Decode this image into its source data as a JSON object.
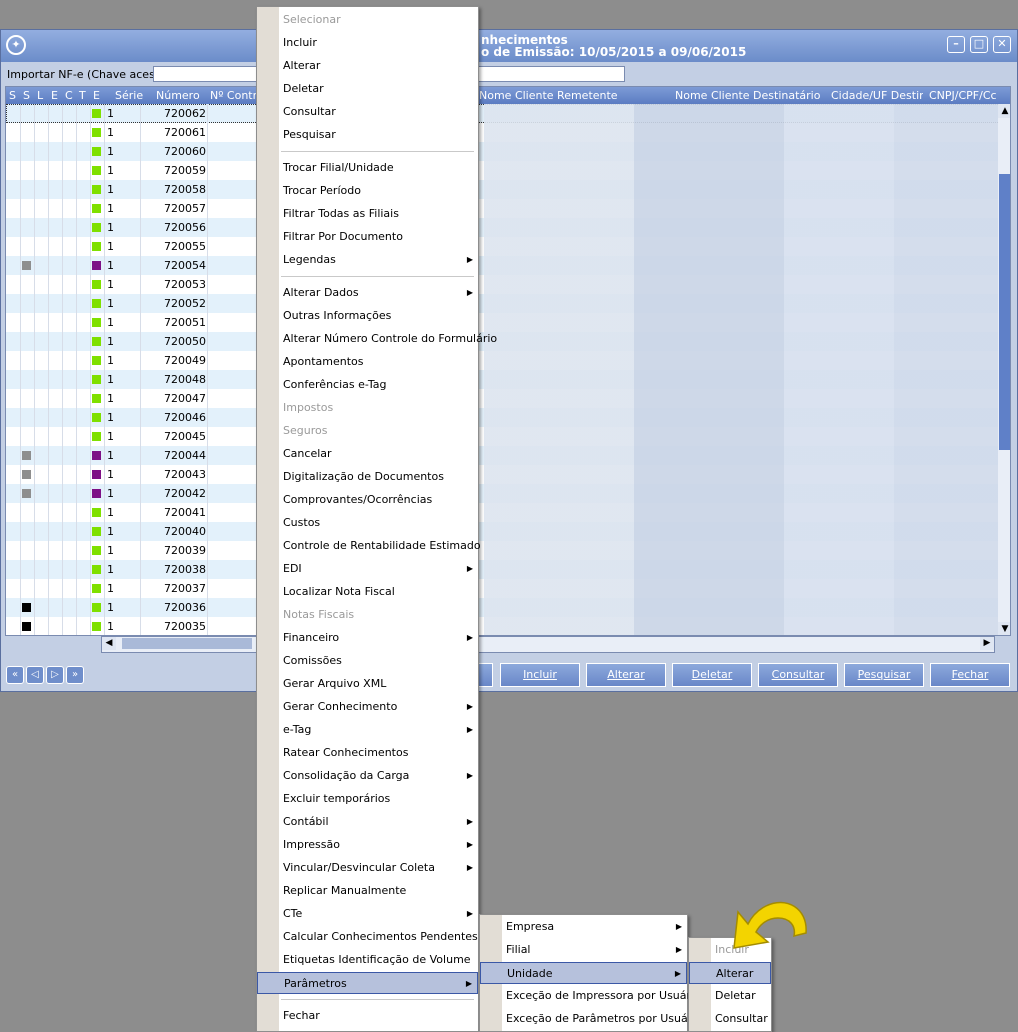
{
  "window": {
    "title_line1": "nhecimentos",
    "title_line2": "o de Emissão: 10/05/2015 a 09/06/2015",
    "logo": "compass-logo",
    "controls": [
      "minimize-icon",
      "maximize-icon",
      "close-icon"
    ]
  },
  "import": {
    "label": "Importar NF-e (Chave acesso):",
    "value": ""
  },
  "grid": {
    "headers": {
      "s": "S",
      "s2": "S",
      "l": "L",
      "e": "E",
      "c": "C",
      "t": "T",
      "e2": "E",
      "serie": "Série",
      "numero": "Número",
      "controle": "Nº Contro",
      "remetente": "Nome Cliente Remetente",
      "destinatario": "Nome Cliente Destinatário",
      "cidade": "Cidade/UF Destino",
      "cnpj": "CNPJ/CPF/Cc"
    },
    "rows": [
      {
        "serie": "1",
        "numero": "720062",
        "s_mark": "",
        "e_mark": "green"
      },
      {
        "serie": "1",
        "numero": "720061",
        "s_mark": "",
        "e_mark": "green"
      },
      {
        "serie": "1",
        "numero": "720060",
        "s_mark": "",
        "e_mark": "green"
      },
      {
        "serie": "1",
        "numero": "720059",
        "s_mark": "",
        "e_mark": "green"
      },
      {
        "serie": "1",
        "numero": "720058",
        "s_mark": "",
        "e_mark": "green"
      },
      {
        "serie": "1",
        "numero": "720057",
        "s_mark": "",
        "e_mark": "green"
      },
      {
        "serie": "1",
        "numero": "720056",
        "s_mark": "",
        "e_mark": "green"
      },
      {
        "serie": "1",
        "numero": "720055",
        "s_mark": "",
        "e_mark": "green"
      },
      {
        "serie": "1",
        "numero": "720054",
        "s_mark": "gray",
        "e_mark": "purple"
      },
      {
        "serie": "1",
        "numero": "720053",
        "s_mark": "",
        "e_mark": "green"
      },
      {
        "serie": "1",
        "numero": "720052",
        "s_mark": "",
        "e_mark": "green"
      },
      {
        "serie": "1",
        "numero": "720051",
        "s_mark": "",
        "e_mark": "green"
      },
      {
        "serie": "1",
        "numero": "720050",
        "s_mark": "",
        "e_mark": "green"
      },
      {
        "serie": "1",
        "numero": "720049",
        "s_mark": "",
        "e_mark": "green"
      },
      {
        "serie": "1",
        "numero": "720048",
        "s_mark": "",
        "e_mark": "green"
      },
      {
        "serie": "1",
        "numero": "720047",
        "s_mark": "",
        "e_mark": "green"
      },
      {
        "serie": "1",
        "numero": "720046",
        "s_mark": "",
        "e_mark": "green"
      },
      {
        "serie": "1",
        "numero": "720045",
        "s_mark": "",
        "e_mark": "green"
      },
      {
        "serie": "1",
        "numero": "720044",
        "s_mark": "gray",
        "e_mark": "purple"
      },
      {
        "serie": "1",
        "numero": "720043",
        "s_mark": "gray",
        "e_mark": "purple"
      },
      {
        "serie": "1",
        "numero": "720042",
        "s_mark": "gray",
        "e_mark": "purple"
      },
      {
        "serie": "1",
        "numero": "720041",
        "s_mark": "",
        "e_mark": "green"
      },
      {
        "serie": "1",
        "numero": "720040",
        "s_mark": "",
        "e_mark": "green"
      },
      {
        "serie": "1",
        "numero": "720039",
        "s_mark": "",
        "e_mark": "green"
      },
      {
        "serie": "1",
        "numero": "720038",
        "s_mark": "",
        "e_mark": "green"
      },
      {
        "serie": "1",
        "numero": "720037",
        "s_mark": "",
        "e_mark": "green"
      },
      {
        "serie": "1",
        "numero": "720036",
        "s_mark": "black",
        "e_mark": "green"
      },
      {
        "serie": "1",
        "numero": "720035",
        "s_mark": "black",
        "e_mark": "green"
      }
    ]
  },
  "nav_buttons": [
    "first-icon",
    "prev-icon",
    "next-icon",
    "last-icon"
  ],
  "actions": [
    "Incluir",
    "Alterar",
    "Deletar",
    "Consultar",
    "Pesquisar",
    "Fechar"
  ],
  "context_menu": {
    "items": [
      {
        "label": "Selecionar",
        "disabled": true,
        "sub": false
      },
      {
        "label": "Incluir",
        "disabled": false,
        "sub": false
      },
      {
        "label": "Alterar",
        "disabled": false,
        "sub": false
      },
      {
        "label": "Deletar",
        "disabled": false,
        "sub": false
      },
      {
        "label": "Consultar",
        "disabled": false,
        "sub": false
      },
      {
        "label": "Pesquisar",
        "disabled": false,
        "sub": false
      },
      {
        "label": "Trocar Filial/Unidade",
        "disabled": false,
        "sub": false
      },
      {
        "label": "Trocar Período",
        "disabled": false,
        "sub": false
      },
      {
        "label": "Filtrar Todas as Filiais",
        "disabled": false,
        "sub": false
      },
      {
        "label": "Filtrar Por Documento",
        "disabled": false,
        "sub": false
      },
      {
        "label": "Legendas",
        "disabled": false,
        "sub": true
      },
      {
        "label": "Alterar Dados",
        "disabled": false,
        "sub": true
      },
      {
        "label": "Outras Informações",
        "disabled": false,
        "sub": false
      },
      {
        "label": "Alterar Número Controle do Formulário",
        "disabled": false,
        "sub": false
      },
      {
        "label": "Apontamentos",
        "disabled": false,
        "sub": false
      },
      {
        "label": "Conferências e-Tag",
        "disabled": false,
        "sub": false
      },
      {
        "label": "Impostos",
        "disabled": true,
        "sub": false
      },
      {
        "label": "Seguros",
        "disabled": true,
        "sub": false
      },
      {
        "label": "Cancelar",
        "disabled": false,
        "sub": false
      },
      {
        "label": "Digitalização de Documentos",
        "disabled": false,
        "sub": false
      },
      {
        "label": "Comprovantes/Ocorrências",
        "disabled": false,
        "sub": false
      },
      {
        "label": "Custos",
        "disabled": false,
        "sub": false
      },
      {
        "label": "Controle de Rentabilidade Estimado",
        "disabled": false,
        "sub": false
      },
      {
        "label": "EDI",
        "disabled": false,
        "sub": true
      },
      {
        "label": "Localizar Nota Fiscal",
        "disabled": false,
        "sub": false
      },
      {
        "label": "Notas Fiscais",
        "disabled": true,
        "sub": false
      },
      {
        "label": "Financeiro",
        "disabled": false,
        "sub": true
      },
      {
        "label": "Comissões",
        "disabled": false,
        "sub": false
      },
      {
        "label": "Gerar Arquivo XML",
        "disabled": false,
        "sub": false
      },
      {
        "label": "Gerar Conhecimento",
        "disabled": false,
        "sub": true
      },
      {
        "label": "e-Tag",
        "disabled": false,
        "sub": true
      },
      {
        "label": "Ratear Conhecimentos",
        "disabled": false,
        "sub": false
      },
      {
        "label": "Consolidação da Carga",
        "disabled": false,
        "sub": true
      },
      {
        "label": "Excluir temporários",
        "disabled": false,
        "sub": false
      },
      {
        "label": "Contábil",
        "disabled": false,
        "sub": true
      },
      {
        "label": "Impressão",
        "disabled": false,
        "sub": true
      },
      {
        "label": "Vincular/Desvincular Coleta",
        "disabled": false,
        "sub": true
      },
      {
        "label": "Replicar Manualmente",
        "disabled": false,
        "sub": false
      },
      {
        "label": "CTe",
        "disabled": false,
        "sub": true
      },
      {
        "label": "Calcular Conhecimentos Pendentes",
        "disabled": false,
        "sub": false
      },
      {
        "label": "Etiquetas Identificação de Volume",
        "disabled": false,
        "sub": false
      },
      {
        "label": "Parâmetros",
        "disabled": false,
        "sub": true,
        "highlight": true
      },
      {
        "label": "Fechar",
        "disabled": false,
        "sub": false
      }
    ]
  },
  "submenu_parametros": {
    "items": [
      {
        "label": "Empresa",
        "sub": true
      },
      {
        "label": "Filial",
        "sub": true
      },
      {
        "label": "Unidade",
        "sub": true,
        "highlight": true
      },
      {
        "label": "Exceção de Impressora por Usuário",
        "sub": false
      },
      {
        "label": "Exceção de Parâmetros por Usuário",
        "sub": false
      }
    ]
  },
  "submenu_unidade": {
    "items": [
      {
        "label": "Incluir",
        "disabled": true
      },
      {
        "label": "Alterar",
        "disabled": false,
        "highlight": true
      },
      {
        "label": "Deletar",
        "disabled": false
      },
      {
        "label": "Consultar",
        "disabled": false
      }
    ]
  },
  "colors": {
    "accent": "#6b8cc9",
    "highlight": "#b6c1dc",
    "green_mark": "#7fe000",
    "purple_mark": "#7d0f86",
    "gray_mark": "#8e8e8e",
    "black_mark": "#000000",
    "annotation_arrow": "#f3d400"
  }
}
